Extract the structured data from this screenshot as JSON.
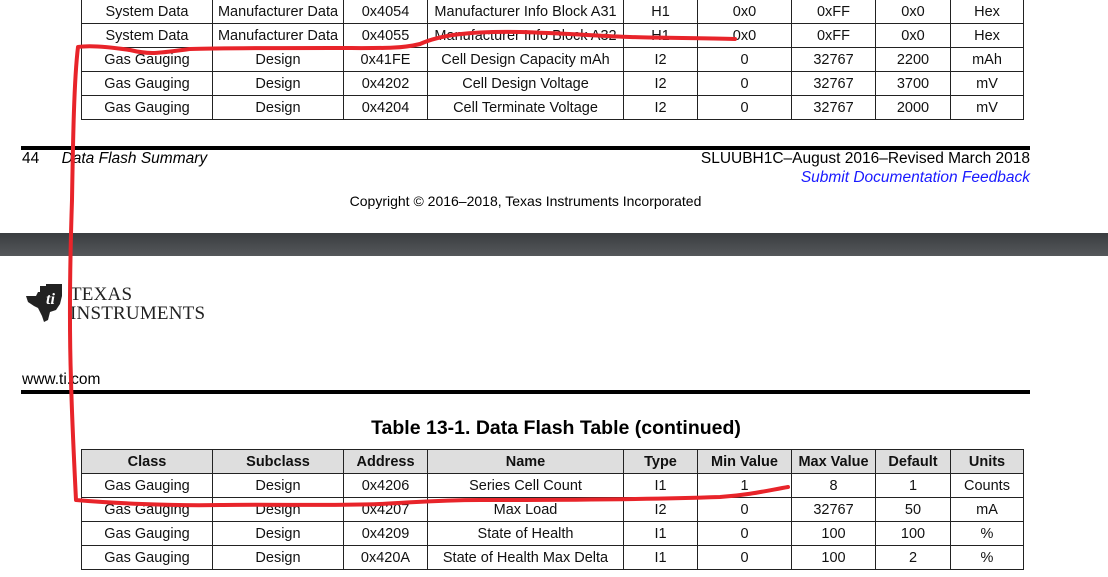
{
  "table": {
    "columns": [
      "Class",
      "Subclass",
      "Address",
      "Name",
      "Type",
      "Min Value",
      "Max Value",
      "Default",
      "Units"
    ],
    "top_rows": [
      [
        "System Data",
        "Manufacturer Data",
        "0x4054",
        "Manufacturer Info Block A31",
        "H1",
        "0x0",
        "0xFF",
        "0x0",
        "Hex"
      ],
      [
        "System Data",
        "Manufacturer Data",
        "0x4055",
        "Manufacturer Info Block A32",
        "H1",
        "0x0",
        "0xFF",
        "0x0",
        "Hex"
      ],
      [
        "Gas Gauging",
        "Design",
        "0x41FE",
        "Cell Design Capacity mAh",
        "I2",
        "0",
        "32767",
        "2200",
        "mAh"
      ],
      [
        "Gas Gauging",
        "Design",
        "0x4202",
        "Cell Design Voltage",
        "I2",
        "0",
        "32767",
        "3700",
        "mV"
      ],
      [
        "Gas Gauging",
        "Design",
        "0x4204",
        "Cell Terminate Voltage",
        "I2",
        "0",
        "32767",
        "2000",
        "mV"
      ]
    ],
    "bottom_rows": [
      [
        "Gas Gauging",
        "Design",
        "0x4206",
        "Series Cell Count",
        "I1",
        "1",
        "8",
        "1",
        "Counts"
      ],
      [
        "Gas Gauging",
        "Design",
        "0x4207",
        "Max Load",
        "I2",
        "0",
        "32767",
        "50",
        "mA"
      ],
      [
        "Gas Gauging",
        "Design",
        "0x4209",
        "State of Health",
        "I1",
        "0",
        "100",
        "100",
        "%"
      ],
      [
        "Gas Gauging",
        "Design",
        "0x420A",
        "State of Health Max Delta",
        "I1",
        "0",
        "100",
        "2",
        "%"
      ]
    ]
  },
  "footer": {
    "page_number": "44",
    "section_title": "Data Flash Summary",
    "doc_id": "SLUUBH1C–August 2016–Revised March 2018",
    "feedback_link": "Submit Documentation Feedback",
    "copyright": "Copyright © 2016–2018, Texas Instruments Incorporated"
  },
  "header": {
    "logo_line1": "TEXAS",
    "logo_line2": "INSTRUMENTS",
    "website": "www.ti.com"
  },
  "table_title": "Table 13-1. Data Flash Table (continued)",
  "annotation": {
    "color": "#e8242a",
    "description": "red freehand outline drawn over the page"
  }
}
